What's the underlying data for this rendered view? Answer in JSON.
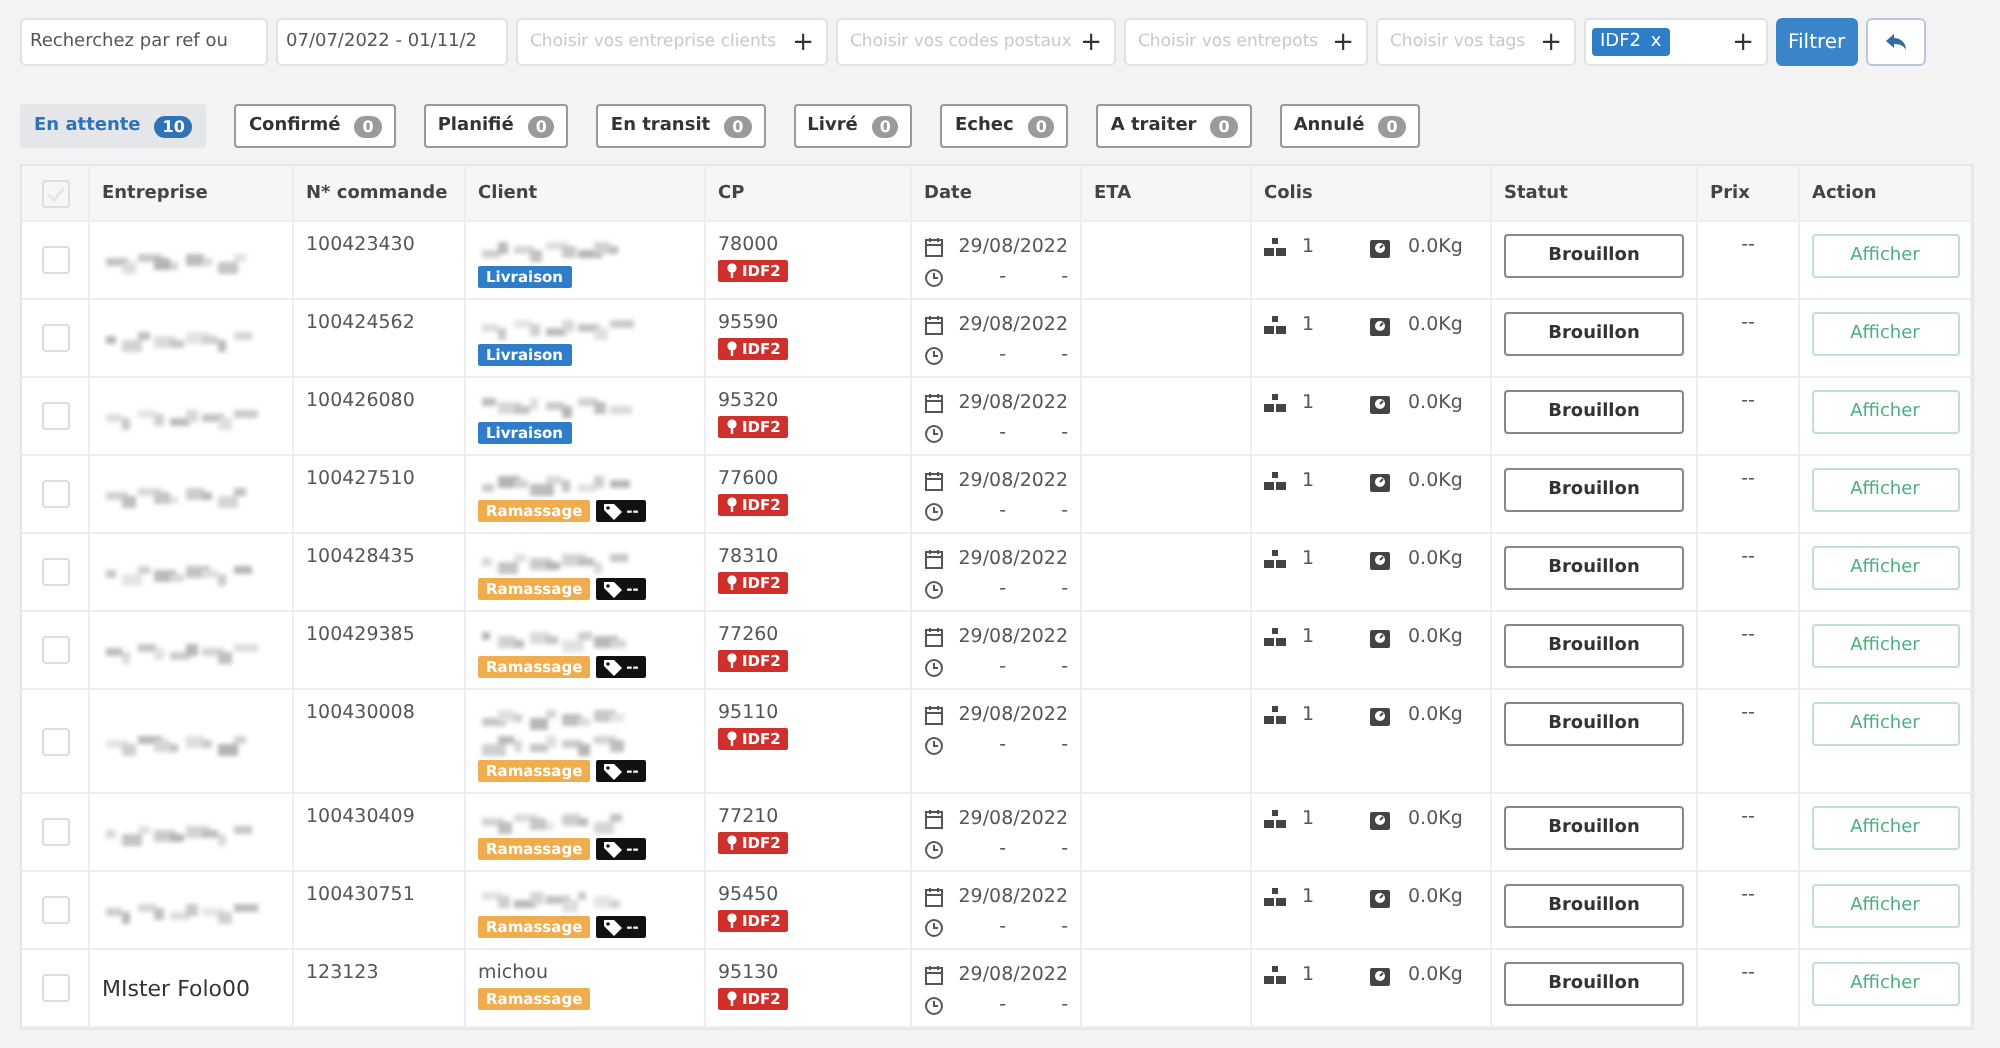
{
  "filters": [
    {
      "kind": "input",
      "value": "Recherchez par ref ou"
    },
    {
      "kind": "input",
      "value": "07/07/2022 - 01/11/2"
    },
    {
      "kind": "select",
      "placeholder": "Choisir vos entreprise clients",
      "plus": "+"
    },
    {
      "kind": "select",
      "placeholder": "Choisir vos codes postaux",
      "plus": "+"
    },
    {
      "kind": "select",
      "placeholder": "Choisir vos entrepots",
      "plus": "+"
    },
    {
      "kind": "select",
      "placeholder": "Choisir vos tags",
      "plus": "+"
    },
    {
      "kind": "chips",
      "chips": [
        {
          "label": "IDF2",
          "remove": "x"
        }
      ],
      "plus": "+"
    }
  ],
  "filter_button": "Filtrer",
  "status_tabs": [
    {
      "label": "En attente",
      "count": "10",
      "selected": true
    },
    {
      "label": "Confirmé",
      "count": "0",
      "selected": false
    },
    {
      "label": "Planifié",
      "count": "0",
      "selected": false
    },
    {
      "label": "En transit",
      "count": "0",
      "selected": false
    },
    {
      "label": "Livré",
      "count": "0",
      "selected": false
    },
    {
      "label": "Echec",
      "count": "0",
      "selected": false
    },
    {
      "label": "A traiter",
      "count": "0",
      "selected": false
    },
    {
      "label": "Annulé",
      "count": "0",
      "selected": false
    }
  ],
  "table": {
    "select_all": {
      "disabled": true
    },
    "columns": [
      "Entreprise",
      "N* commande",
      "Client",
      "CP",
      "Date",
      "ETA",
      "Colis",
      "Statut",
      "Prix",
      "Action"
    ],
    "rows": [
      {
        "checked": false,
        "entreprise": {
          "kind": "blurred"
        },
        "commande": "100423430",
        "client": {
          "kind": "blurred"
        },
        "type": {
          "kind": "livraison",
          "label": "Livraison"
        },
        "cp": "78000",
        "zone": "IDF2",
        "date": "29/08/2022",
        "time": [
          "-",
          "-"
        ],
        "colis": "1",
        "poids": "0.0Kg",
        "statut": "Brouillon",
        "prix": "--",
        "action": "Afficher"
      },
      {
        "checked": false,
        "entreprise": {
          "kind": "blurred"
        },
        "commande": "100424562",
        "client": {
          "kind": "blurred"
        },
        "type": {
          "kind": "livraison",
          "label": "Livraison"
        },
        "cp": "95590",
        "zone": "IDF2",
        "date": "29/08/2022",
        "time": [
          "-",
          "-"
        ],
        "colis": "1",
        "poids": "0.0Kg",
        "statut": "Brouillon",
        "prix": "--",
        "action": "Afficher"
      },
      {
        "checked": false,
        "entreprise": {
          "kind": "blurred"
        },
        "commande": "100426080",
        "client": {
          "kind": "blurred"
        },
        "type": {
          "kind": "livraison",
          "label": "Livraison"
        },
        "cp": "95320",
        "zone": "IDF2",
        "date": "29/08/2022",
        "time": [
          "-",
          "-"
        ],
        "colis": "1",
        "poids": "0.0Kg",
        "statut": "Brouillon",
        "prix": "--",
        "action": "Afficher"
      },
      {
        "checked": false,
        "entreprise": {
          "kind": "blurred"
        },
        "commande": "100427510",
        "client": {
          "kind": "blurred"
        },
        "type": {
          "kind": "ramassage",
          "label": "Ramassage"
        },
        "tag": "--",
        "cp": "77600",
        "zone": "IDF2",
        "date": "29/08/2022",
        "time": [
          "-",
          "-"
        ],
        "colis": "1",
        "poids": "0.0Kg",
        "statut": "Brouillon",
        "prix": "--",
        "action": "Afficher"
      },
      {
        "checked": false,
        "entreprise": {
          "kind": "blurred"
        },
        "commande": "100428435",
        "client": {
          "kind": "blurred"
        },
        "type": {
          "kind": "ramassage",
          "label": "Ramassage"
        },
        "tag": "--",
        "cp": "78310",
        "zone": "IDF2",
        "date": "29/08/2022",
        "time": [
          "-",
          "-"
        ],
        "colis": "1",
        "poids": "0.0Kg",
        "statut": "Brouillon",
        "prix": "--",
        "action": "Afficher"
      },
      {
        "checked": false,
        "entreprise": {
          "kind": "blurred"
        },
        "commande": "100429385",
        "client": {
          "kind": "blurred"
        },
        "type": {
          "kind": "ramassage",
          "label": "Ramassage"
        },
        "tag": "--",
        "cp": "77260",
        "zone": "IDF2",
        "date": "29/08/2022",
        "time": [
          "-",
          "-"
        ],
        "colis": "1",
        "poids": "0.0Kg",
        "statut": "Brouillon",
        "prix": "--",
        "action": "Afficher"
      },
      {
        "checked": false,
        "entreprise": {
          "kind": "blurred"
        },
        "commande": "100430008",
        "client": {
          "kind": "blurred",
          "tall": true
        },
        "type": {
          "kind": "ramassage",
          "label": "Ramassage"
        },
        "tag": "--",
        "cp": "95110",
        "zone": "IDF2",
        "date": "29/08/2022",
        "time": [
          "-",
          "-"
        ],
        "colis": "1",
        "poids": "0.0Kg",
        "statut": "Brouillon",
        "prix": "--",
        "action": "Afficher"
      },
      {
        "checked": false,
        "entreprise": {
          "kind": "blurred"
        },
        "commande": "100430409",
        "client": {
          "kind": "blurred"
        },
        "type": {
          "kind": "ramassage",
          "label": "Ramassage"
        },
        "tag": "--",
        "cp": "77210",
        "zone": "IDF2",
        "date": "29/08/2022",
        "time": [
          "-",
          "-"
        ],
        "colis": "1",
        "poids": "0.0Kg",
        "statut": "Brouillon",
        "prix": "--",
        "action": "Afficher"
      },
      {
        "checked": false,
        "entreprise": {
          "kind": "blurred"
        },
        "commande": "100430751",
        "client": {
          "kind": "blurred"
        },
        "type": {
          "kind": "ramassage",
          "label": "Ramassage"
        },
        "tag": "--",
        "cp": "95450",
        "zone": "IDF2",
        "date": "29/08/2022",
        "time": [
          "-",
          "-"
        ],
        "colis": "1",
        "poids": "0.0Kg",
        "statut": "Brouillon",
        "prix": "--",
        "action": "Afficher"
      },
      {
        "checked": false,
        "entreprise": {
          "kind": "text",
          "text": "MIster Folo00"
        },
        "commande": "123123",
        "client": {
          "kind": "text",
          "text": "michou"
        },
        "type": {
          "kind": "ramassage",
          "label": "Ramassage"
        },
        "cp": "95130",
        "zone": "IDF2",
        "date": "29/08/2022",
        "time": [
          "-",
          "-"
        ],
        "colis": "1",
        "poids": "0.0Kg",
        "statut": "Brouillon",
        "prix": "--",
        "action": "Afficher"
      }
    ]
  }
}
